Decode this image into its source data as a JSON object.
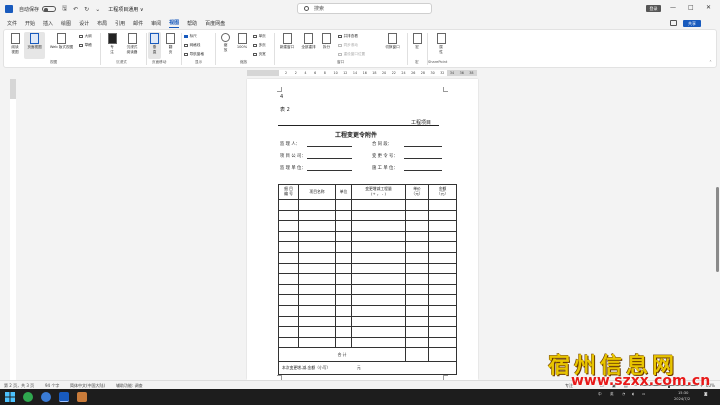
{
  "titlebar": {
    "autosave_label": "自动保存",
    "autosave_state": "关",
    "doc_title": "工程项目通用 ∨",
    "search_placeholder": "搜索",
    "signin": "登录",
    "minimize": "—",
    "restore": "□",
    "close": "✕"
  },
  "menu": {
    "items": [
      "文件",
      "开始",
      "插入",
      "绘图",
      "设计",
      "布局",
      "引用",
      "邮件",
      "审阅",
      "视图",
      "帮助",
      "百度网盘"
    ],
    "active_index": 9,
    "share": "共享"
  },
  "ribbon": {
    "views": {
      "read_mode": "阅读\n视图",
      "print_layout": "页面视图",
      "web_layout": "Web 版式视图",
      "outline": "大纲",
      "draft": "草稿",
      "group": "视图"
    },
    "immersive": {
      "focus": "专\n注",
      "reader": "沉浸式\n阅读器",
      "group": "沉浸式"
    },
    "page_move": {
      "vertical": "垂\n直",
      "side": "翻\n页",
      "group": "页面移动"
    },
    "show": {
      "ruler": "标尺",
      "gridlines": "网格线",
      "nav_pane": "导航窗格",
      "group": "显示"
    },
    "zoom": {
      "zoom": "缩\n放",
      "pct": "100%",
      "one_page": "单页",
      "multi_page": "多页",
      "page_width": "页宽",
      "group": "缩放"
    },
    "window": {
      "new_window": "新建窗口",
      "arrange_all": "全部重排",
      "split": "拆分",
      "side_by_side": "并排查看",
      "sync_scroll": "同步滚动",
      "reset_pos": "重设窗口位置",
      "switch": "切换窗口",
      "group": "窗口"
    },
    "macros": {
      "macros": "宏",
      "group": "宏"
    },
    "sharepoint": {
      "properties": "属\n性",
      "group": "SharePoint"
    }
  },
  "ruler_numbers": [
    "2",
    "2",
    "4",
    "6",
    "8",
    "10",
    "12",
    "14",
    "16",
    "18",
    "20",
    "22",
    "24",
    "26",
    "28",
    "30",
    "32",
    "34",
    "36",
    "38"
  ],
  "document": {
    "line1": "4",
    "line2": "表 2",
    "project_label": "工程项目",
    "title": "工程变更令附件",
    "fields": [
      {
        "label": "监  理  人：",
        "right_label": "合  同  段："
      },
      {
        "label": "项 目 公 司：",
        "right_label": "变  更  令  号："
      },
      {
        "label": "监 理 单 位：",
        "right_label": "施  工  单  位："
      }
    ],
    "table": {
      "headers": [
        "细 目\n编 号",
        "项目名称",
        "单位",
        "变更增减工程量\n(+ ， - )",
        "单价\n（元）",
        "金额\n（元）"
      ],
      "rows": 14,
      "total_label": "合    计",
      "footer": "本次变更增-减-金额（小写）                      元"
    }
  },
  "status": {
    "page": "第 2 页，共 3 页",
    "words": "94 个字",
    "language": "简体中文(中国大陆)",
    "accessibility": "辅助功能: 调查",
    "focus": "专注",
    "zoom": "80%"
  },
  "taskbar": {
    "time": "15:30",
    "date": "2024/7/2",
    "ime": "中",
    "lang": "英"
  },
  "watermark": {
    "top": "宿州信息网",
    "bottom": "www.szxx.com.cn"
  },
  "colors": {
    "accent": "#185abd",
    "watermark_yellow": "#e8c500",
    "watermark_red": "#e81a1a"
  }
}
